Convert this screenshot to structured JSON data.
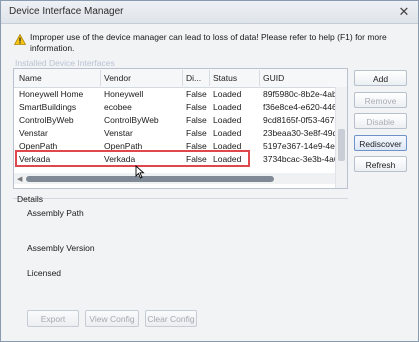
{
  "window": {
    "title": "Device Interface Manager",
    "close_glyph": "✕"
  },
  "warning": {
    "icon": "warning-icon",
    "text": "Improper use of the device manager can lead to loss of data!  Please refer to help  (F1) for more information."
  },
  "installed_label": "Installed Device Interfaces",
  "table": {
    "columns": [
      "Name",
      "Vendor",
      "Di...",
      "Status",
      "GUID"
    ],
    "rows": [
      [
        "Honeywell Home",
        "Honeywell",
        "False",
        "Loaded",
        "89f5980c-8b2e-4ab5"
      ],
      [
        "SmartBuildings",
        "ecobee",
        "False",
        "Loaded",
        "f36e8ce4-e620-446b"
      ],
      [
        "ControlByWeb",
        "ControlByWeb",
        "False",
        "Loaded",
        "9cd8165f-0f53-4675"
      ],
      [
        "Venstar",
        "Venstar",
        "False",
        "Loaded",
        "23beaa30-3e8f-49d5"
      ],
      [
        "OpenPath",
        "OpenPath",
        "False",
        "Loaded",
        "5197e367-14e9-4e9"
      ],
      [
        "Verkada",
        "Verkada",
        "False",
        "Loaded",
        "3734bcac-3e3b-4a61"
      ]
    ],
    "highlighted_row": "Verkada"
  },
  "side_buttons": {
    "add": "Add",
    "remove": "Remove",
    "disable": "Disable",
    "rediscover": "Rediscover",
    "refresh": "Refresh"
  },
  "details": {
    "label": "Details",
    "assembly_path": "Assembly Path",
    "assembly_version": "Assembly Version",
    "licensed": "Licensed"
  },
  "bottom_buttons": {
    "export": "Export",
    "view_config": "View Config",
    "clear_config": "Clear Config"
  },
  "colors": {
    "highlight": "#e0474c",
    "accent": "#6f93c9"
  }
}
